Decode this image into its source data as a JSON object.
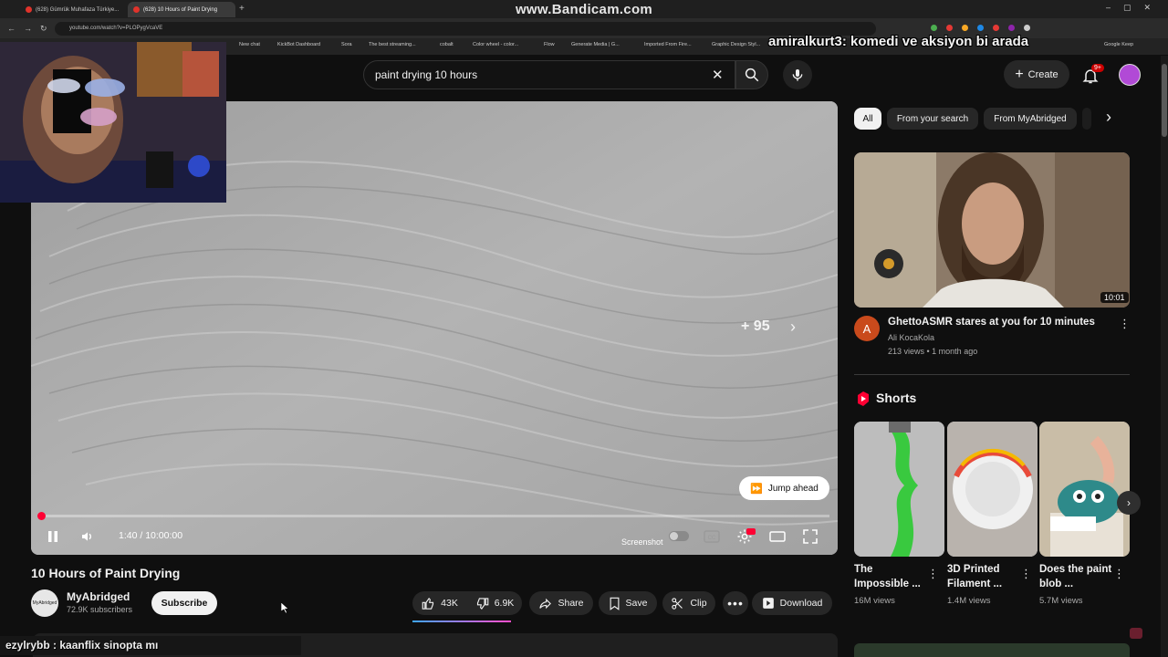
{
  "browser": {
    "tabs": [
      {
        "label": "(628) Gümrük Muhafaza Türkiye..."
      },
      {
        "label": "(628) 10 Hours of Paint Drying"
      }
    ],
    "url": "youtube.com/watch?v=PLOPygVcaVE",
    "bookmarks": [
      "New chat",
      "KickBot Dashboard",
      "Sora",
      "The best streaming...",
      "cobalt",
      "Color wheel - color...",
      "Flow",
      "Generate Media | G...",
      "Imported From Fire...",
      "Graphic Design Styl...",
      "Google Keep"
    ],
    "watermark": "www.Bandicam.com"
  },
  "overlay": {
    "chat_top": "amiralkurt3: komedi ve aksiyon bi arada",
    "chat_bottom": "ezylrybb : kaanflix sinopta mı"
  },
  "header": {
    "search_value": "paint drying 10 hours",
    "create_label": "Create",
    "notifications_badge": "9+"
  },
  "player": {
    "skip_count": "+ 95",
    "jump_label": "Jump ahead",
    "time": "1:40 / 10:00:00",
    "progress_fraction": 0.0028,
    "screenshot_label": "Screenshot"
  },
  "video": {
    "title": "10 Hours of Paint Drying",
    "channel": "MyAbridged",
    "subscribers": "72.9K subscribers",
    "subscribe_label": "Subscribe",
    "likes": "43K",
    "dislikes": "6.9K",
    "share_label": "Share",
    "save_label": "Save",
    "clip_label": "Clip",
    "download_label": "Download"
  },
  "sidebar": {
    "chips": [
      "All",
      "From your search",
      "From MyAbridged"
    ],
    "rec": {
      "duration": "10:01",
      "avatar_letter": "A",
      "title": "GhettoASMR stares at you for 10 minutes",
      "channel": "Ali KocaKola",
      "meta": "213 views • 1 month ago"
    },
    "shorts_label": "Shorts",
    "shorts": [
      {
        "title": "The Impossible ...",
        "views": "16M views"
      },
      {
        "title": "3D Printed Filament ...",
        "views": "1.4M views"
      },
      {
        "title": "Does the paint blob ...",
        "views": "5.7M views"
      }
    ]
  }
}
